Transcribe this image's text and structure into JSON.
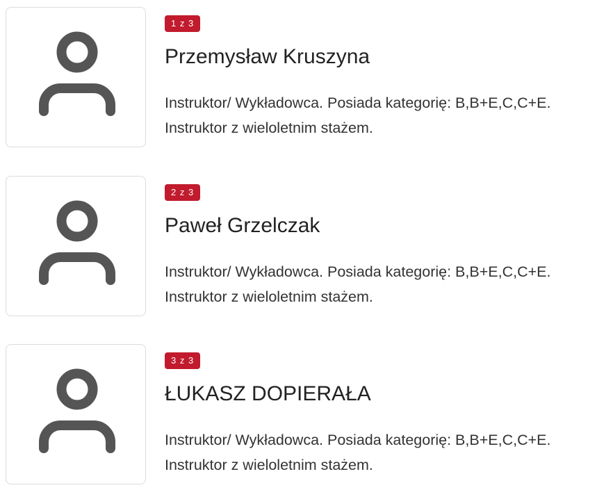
{
  "instructors": [
    {
      "badge": "1 z 3",
      "name": "Przemysław Kruszyna",
      "description": "Instruktor/ Wykładowca. Posiada kategorię: B,B+E,C,C+E. Instruktor z wieloletnim stażem.",
      "icon": "user-icon"
    },
    {
      "badge": "2 z 3",
      "name": "Paweł Grzelczak",
      "description": "Instruktor/ Wykładowca. Posiada kategorię: B,B+E,C,C+E. Instruktor z wieloletnim stażem.",
      "icon": "user-icon"
    },
    {
      "badge": "3 z 3",
      "name": "ŁUKASZ DOPIERAŁA",
      "description": "Instruktor/ Wykładowca. Posiada kategorię: B,B+E,C,C+E. Instruktor z wieloletnim stażem.",
      "icon": "user-icon"
    }
  ],
  "colors": {
    "badge_bg": "#c11b2d",
    "icon": "#555555",
    "border": "#dcdcdc"
  }
}
